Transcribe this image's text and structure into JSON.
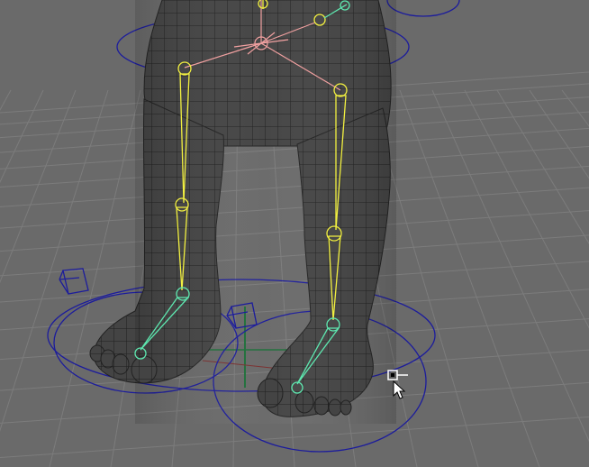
{
  "viewport": {
    "kind": "3d-viewport",
    "background_color": "#6a6a6a",
    "grid_color": "#7c7c7c",
    "mesh_fill_color": "#444444",
    "mesh_wire_color": "#1e1e1e",
    "joint_yellow_color": "#f2f040",
    "joint_green_color": "#5ee8b0",
    "joint_pink_color": "#f0a0a0",
    "control_curve_color": "#1c1c9c",
    "axis_green_color": "#1f6f3a",
    "axis_red_color": "#7a2f2f"
  },
  "cursor": {
    "icon": "arrow-cursor-with-move-tool-glyph"
  }
}
